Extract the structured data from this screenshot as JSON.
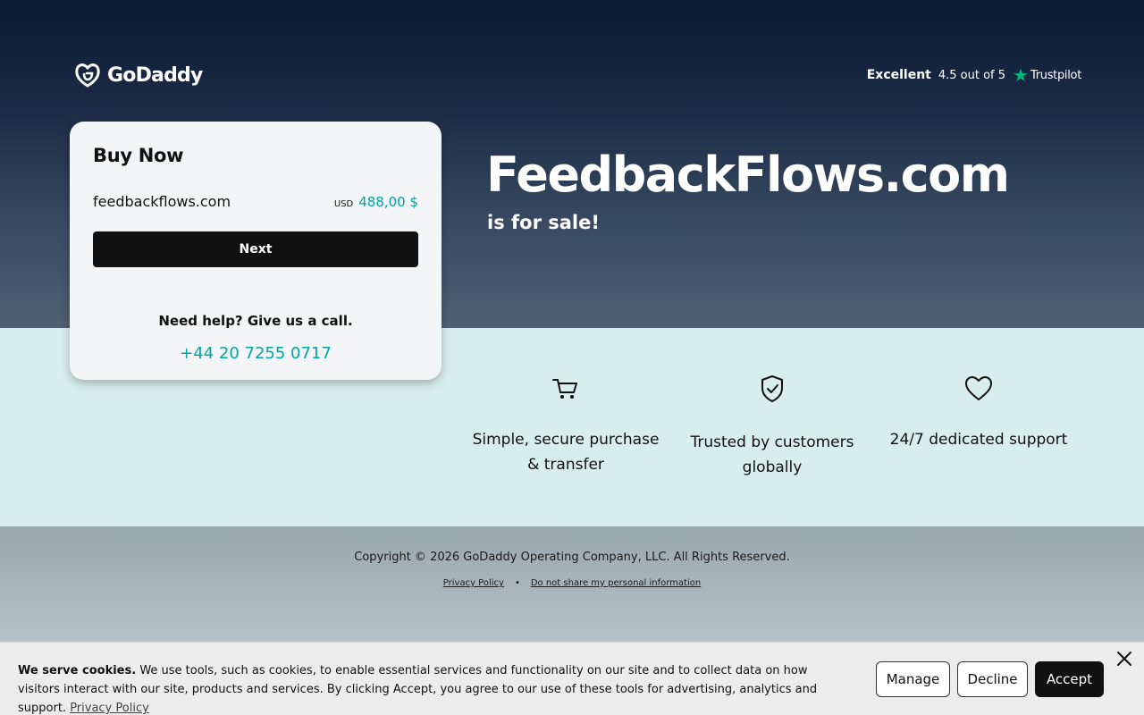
{
  "logo": {
    "text": "GoDaddy",
    "icon": "godaddy-logo-icon"
  },
  "trustpilot": {
    "excellent": "Excellent",
    "rating": "4.5 out of 5",
    "brand": "Trustpilot",
    "star_icon": "star-icon",
    "star_color": "#00b67a"
  },
  "card": {
    "title": "Buy Now",
    "domain": "feedbackflows.com",
    "currency": "USD",
    "price": "488,00 $",
    "next_label": "Next",
    "help_text": "Need help? Give us a call.",
    "phone": "+44 20 7255 0717"
  },
  "hero": {
    "headline": "FeedbackFlows.com",
    "subhead": "is for sale!"
  },
  "features": [
    {
      "icon": "cart-icon",
      "text": "Simple, secure purchase & transfer"
    },
    {
      "icon": "shield-check-icon",
      "text": "Trusted by customers globally"
    },
    {
      "icon": "heart-icon",
      "text": "24/7 dedicated support"
    }
  ],
  "footer": {
    "copyright": "Copyright © 2026 GoDaddy Operating Company, LLC. All Rights Reserved.",
    "privacy_policy": "Privacy Policy",
    "separator": "•",
    "do_not_share": "Do not share my personal information"
  },
  "cookie": {
    "heading": "We serve cookies.",
    "body": "We use tools, such as cookies, to enable essential services and functionality on our site and to collect data on how visitors interact with our site, products and services. By clicking Accept, you agree to our use of these tools for advertising, analytics and support.",
    "privacy_link": "Privacy Policy",
    "manage_label": "Manage",
    "decline_label": "Decline",
    "accept_label": "Accept",
    "close_icon": "close-icon"
  },
  "colors": {
    "accent_teal": "#00a4a6",
    "button_dark": "#111111",
    "band_bg": "#d8eeec"
  }
}
